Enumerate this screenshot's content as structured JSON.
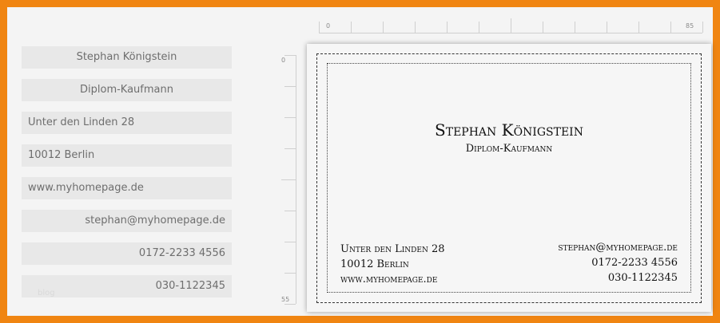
{
  "form": {
    "name": "Stephan Königstein",
    "title": "Diplom-Kaufmann",
    "street": "Unter den Linden 28",
    "city": "10012 Berlin",
    "website": "www.myhomepage.de",
    "email": "stephan@myhomepage.de",
    "mobile": "0172-2233 4556",
    "phone": "030-1122345",
    "watermark": "blog"
  },
  "rulers": {
    "h_start": "0",
    "h_end": "85",
    "v_start": "0",
    "v_end": "55"
  },
  "card": {
    "name": "Stephan Königstein",
    "title": "Diplom-Kaufmann",
    "street": "Unter den Linden 28",
    "city": "10012 Berlin",
    "website": "www.myhomepage.de",
    "email": "stephan@myhomepage.de",
    "mobile": "0172-2233 4556",
    "phone": "030-1122345"
  },
  "colors": {
    "frame": "#f08512",
    "field_bg": "#e8e8e8",
    "card_bg": "#f6f6f6"
  }
}
